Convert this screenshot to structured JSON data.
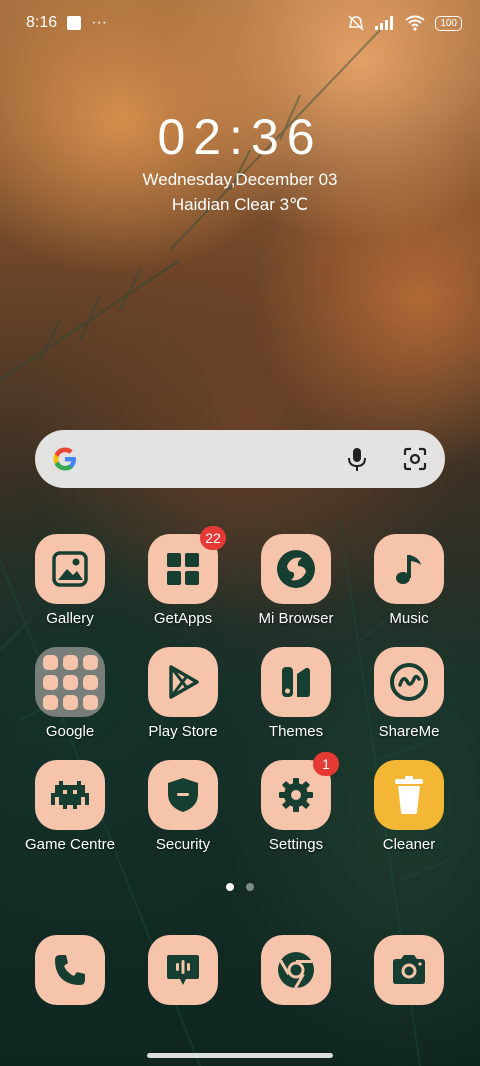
{
  "status_bar": {
    "time": "8:16",
    "battery": "100",
    "icons": [
      "notification-square-icon",
      "more-dots-icon",
      "mute-icon",
      "signal-icon",
      "wifi-icon",
      "battery-icon"
    ]
  },
  "lockclock": {
    "time": "02:36",
    "date": "Wednesday,December 03",
    "weather": "Haidian Clear 3℃"
  },
  "search": {
    "icons": [
      "google-g-icon",
      "mic-icon",
      "lens-icon"
    ]
  },
  "apps": [
    {
      "label": "Gallery",
      "icon": "gallery-icon"
    },
    {
      "label": "GetApps",
      "icon": "getapps-icon",
      "badge": "22"
    },
    {
      "label": "Mi Browser",
      "icon": "browser-icon"
    },
    {
      "label": "Music",
      "icon": "music-icon"
    },
    {
      "label": "Google",
      "icon": "folder-icon"
    },
    {
      "label": "Play Store",
      "icon": "play-store-icon"
    },
    {
      "label": "Themes",
      "icon": "themes-icon"
    },
    {
      "label": "ShareMe",
      "icon": "shareme-icon"
    },
    {
      "label": "Game Centre",
      "icon": "game-icon"
    },
    {
      "label": "Security",
      "icon": "security-icon"
    },
    {
      "label": "Settings",
      "icon": "settings-icon",
      "badge": "1"
    },
    {
      "label": "Cleaner",
      "icon": "cleaner-icon"
    }
  ],
  "dock": [
    {
      "icon": "phone-icon"
    },
    {
      "icon": "messages-icon"
    },
    {
      "icon": "chrome-icon"
    },
    {
      "icon": "camera-icon"
    }
  ],
  "colors": {
    "icon_bg": "#f6c3ab",
    "icon_fg": "#163f31",
    "badge": "#e53935",
    "cleaner_bg": "#f4b735"
  },
  "pages": {
    "count": 2,
    "current": 1
  }
}
